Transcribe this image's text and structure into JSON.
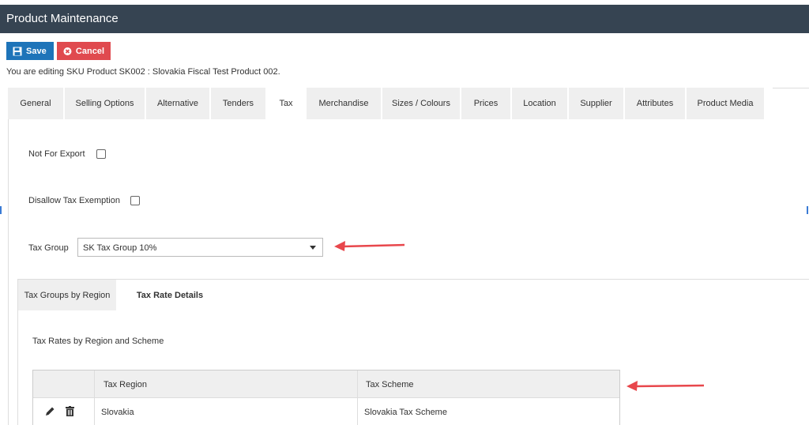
{
  "window": {
    "title": "Product Maintenance"
  },
  "toolbar": {
    "save_label": "Save",
    "cancel_label": "Cancel"
  },
  "status": {
    "editing_text": "You are editing SKU Product SK002 : Slovakia Fiscal Test Product 002."
  },
  "tabs": [
    {
      "label": "General",
      "active": false
    },
    {
      "label": "Selling Options",
      "active": false
    },
    {
      "label": "Alternative",
      "active": false
    },
    {
      "label": "Tenders",
      "active": false
    },
    {
      "label": "Tax",
      "active": true
    },
    {
      "label": "Merchandise",
      "active": false
    },
    {
      "label": "Sizes / Colours",
      "active": false
    },
    {
      "label": "Prices",
      "active": false
    },
    {
      "label": "Location",
      "active": false
    },
    {
      "label": "Supplier",
      "active": false
    },
    {
      "label": "Attributes",
      "active": false
    },
    {
      "label": "Product Media",
      "active": false
    }
  ],
  "tax": {
    "not_for_export_label": "Not For Export",
    "not_for_export_checked": false,
    "disallow_exemption_label": "Disallow Tax Exemption",
    "disallow_exemption_checked": false,
    "tax_group_label": "Tax Group",
    "tax_group_value": "SK Tax Group 10%"
  },
  "subtabs": [
    {
      "label": "Tax Groups by Region",
      "active": true
    },
    {
      "label": "Tax Rate Details",
      "active": false
    }
  ],
  "rates": {
    "heading": "Tax Rates by Region and Scheme",
    "columns": [
      "Tax Region",
      "Tax Scheme"
    ],
    "rows": [
      {
        "region": "Slovakia",
        "scheme": "Slovakia Tax Scheme"
      }
    ]
  },
  "colors": {
    "titlebar": "#364452",
    "save": "#1e74b9",
    "cancel": "#e04a4f",
    "annotation_arrow": "#e8474c"
  }
}
